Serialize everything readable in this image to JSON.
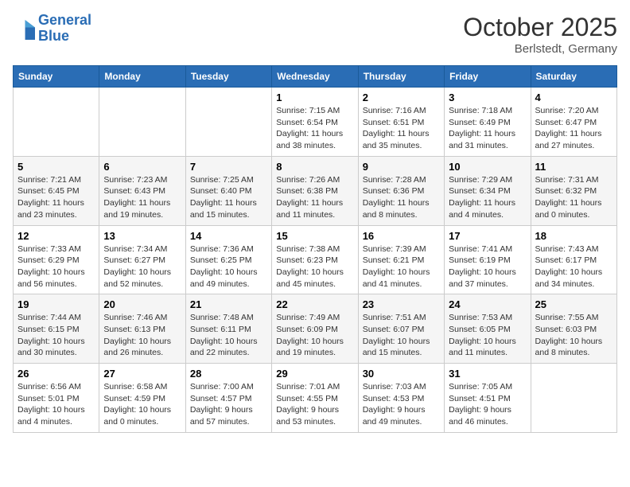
{
  "header": {
    "logo_general": "General",
    "logo_blue": "Blue",
    "month_title": "October 2025",
    "location": "Berlstedt, Germany"
  },
  "days_of_week": [
    "Sunday",
    "Monday",
    "Tuesday",
    "Wednesday",
    "Thursday",
    "Friday",
    "Saturday"
  ],
  "weeks": [
    [
      {
        "day": "",
        "sunrise": "",
        "sunset": "",
        "daylight": ""
      },
      {
        "day": "",
        "sunrise": "",
        "sunset": "",
        "daylight": ""
      },
      {
        "day": "",
        "sunrise": "",
        "sunset": "",
        "daylight": ""
      },
      {
        "day": "1",
        "sunrise": "Sunrise: 7:15 AM",
        "sunset": "Sunset: 6:54 PM",
        "daylight": "Daylight: 11 hours and 38 minutes."
      },
      {
        "day": "2",
        "sunrise": "Sunrise: 7:16 AM",
        "sunset": "Sunset: 6:51 PM",
        "daylight": "Daylight: 11 hours and 35 minutes."
      },
      {
        "day": "3",
        "sunrise": "Sunrise: 7:18 AM",
        "sunset": "Sunset: 6:49 PM",
        "daylight": "Daylight: 11 hours and 31 minutes."
      },
      {
        "day": "4",
        "sunrise": "Sunrise: 7:20 AM",
        "sunset": "Sunset: 6:47 PM",
        "daylight": "Daylight: 11 hours and 27 minutes."
      }
    ],
    [
      {
        "day": "5",
        "sunrise": "Sunrise: 7:21 AM",
        "sunset": "Sunset: 6:45 PM",
        "daylight": "Daylight: 11 hours and 23 minutes."
      },
      {
        "day": "6",
        "sunrise": "Sunrise: 7:23 AM",
        "sunset": "Sunset: 6:43 PM",
        "daylight": "Daylight: 11 hours and 19 minutes."
      },
      {
        "day": "7",
        "sunrise": "Sunrise: 7:25 AM",
        "sunset": "Sunset: 6:40 PM",
        "daylight": "Daylight: 11 hours and 15 minutes."
      },
      {
        "day": "8",
        "sunrise": "Sunrise: 7:26 AM",
        "sunset": "Sunset: 6:38 PM",
        "daylight": "Daylight: 11 hours and 11 minutes."
      },
      {
        "day": "9",
        "sunrise": "Sunrise: 7:28 AM",
        "sunset": "Sunset: 6:36 PM",
        "daylight": "Daylight: 11 hours and 8 minutes."
      },
      {
        "day": "10",
        "sunrise": "Sunrise: 7:29 AM",
        "sunset": "Sunset: 6:34 PM",
        "daylight": "Daylight: 11 hours and 4 minutes."
      },
      {
        "day": "11",
        "sunrise": "Sunrise: 7:31 AM",
        "sunset": "Sunset: 6:32 PM",
        "daylight": "Daylight: 11 hours and 0 minutes."
      }
    ],
    [
      {
        "day": "12",
        "sunrise": "Sunrise: 7:33 AM",
        "sunset": "Sunset: 6:29 PM",
        "daylight": "Daylight: 10 hours and 56 minutes."
      },
      {
        "day": "13",
        "sunrise": "Sunrise: 7:34 AM",
        "sunset": "Sunset: 6:27 PM",
        "daylight": "Daylight: 10 hours and 52 minutes."
      },
      {
        "day": "14",
        "sunrise": "Sunrise: 7:36 AM",
        "sunset": "Sunset: 6:25 PM",
        "daylight": "Daylight: 10 hours and 49 minutes."
      },
      {
        "day": "15",
        "sunrise": "Sunrise: 7:38 AM",
        "sunset": "Sunset: 6:23 PM",
        "daylight": "Daylight: 10 hours and 45 minutes."
      },
      {
        "day": "16",
        "sunrise": "Sunrise: 7:39 AM",
        "sunset": "Sunset: 6:21 PM",
        "daylight": "Daylight: 10 hours and 41 minutes."
      },
      {
        "day": "17",
        "sunrise": "Sunrise: 7:41 AM",
        "sunset": "Sunset: 6:19 PM",
        "daylight": "Daylight: 10 hours and 37 minutes."
      },
      {
        "day": "18",
        "sunrise": "Sunrise: 7:43 AM",
        "sunset": "Sunset: 6:17 PM",
        "daylight": "Daylight: 10 hours and 34 minutes."
      }
    ],
    [
      {
        "day": "19",
        "sunrise": "Sunrise: 7:44 AM",
        "sunset": "Sunset: 6:15 PM",
        "daylight": "Daylight: 10 hours and 30 minutes."
      },
      {
        "day": "20",
        "sunrise": "Sunrise: 7:46 AM",
        "sunset": "Sunset: 6:13 PM",
        "daylight": "Daylight: 10 hours and 26 minutes."
      },
      {
        "day": "21",
        "sunrise": "Sunrise: 7:48 AM",
        "sunset": "Sunset: 6:11 PM",
        "daylight": "Daylight: 10 hours and 22 minutes."
      },
      {
        "day": "22",
        "sunrise": "Sunrise: 7:49 AM",
        "sunset": "Sunset: 6:09 PM",
        "daylight": "Daylight: 10 hours and 19 minutes."
      },
      {
        "day": "23",
        "sunrise": "Sunrise: 7:51 AM",
        "sunset": "Sunset: 6:07 PM",
        "daylight": "Daylight: 10 hours and 15 minutes."
      },
      {
        "day": "24",
        "sunrise": "Sunrise: 7:53 AM",
        "sunset": "Sunset: 6:05 PM",
        "daylight": "Daylight: 10 hours and 11 minutes."
      },
      {
        "day": "25",
        "sunrise": "Sunrise: 7:55 AM",
        "sunset": "Sunset: 6:03 PM",
        "daylight": "Daylight: 10 hours and 8 minutes."
      }
    ],
    [
      {
        "day": "26",
        "sunrise": "Sunrise: 6:56 AM",
        "sunset": "Sunset: 5:01 PM",
        "daylight": "Daylight: 10 hours and 4 minutes."
      },
      {
        "day": "27",
        "sunrise": "Sunrise: 6:58 AM",
        "sunset": "Sunset: 4:59 PM",
        "daylight": "Daylight: 10 hours and 0 minutes."
      },
      {
        "day": "28",
        "sunrise": "Sunrise: 7:00 AM",
        "sunset": "Sunset: 4:57 PM",
        "daylight": "Daylight: 9 hours and 57 minutes."
      },
      {
        "day": "29",
        "sunrise": "Sunrise: 7:01 AM",
        "sunset": "Sunset: 4:55 PM",
        "daylight": "Daylight: 9 hours and 53 minutes."
      },
      {
        "day": "30",
        "sunrise": "Sunrise: 7:03 AM",
        "sunset": "Sunset: 4:53 PM",
        "daylight": "Daylight: 9 hours and 49 minutes."
      },
      {
        "day": "31",
        "sunrise": "Sunrise: 7:05 AM",
        "sunset": "Sunset: 4:51 PM",
        "daylight": "Daylight: 9 hours and 46 minutes."
      },
      {
        "day": "",
        "sunrise": "",
        "sunset": "",
        "daylight": ""
      }
    ]
  ]
}
